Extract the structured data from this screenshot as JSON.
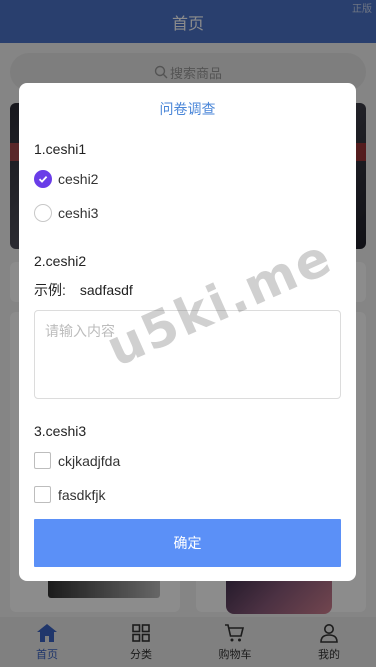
{
  "header": {
    "title": "首页",
    "corner_text": "正版"
  },
  "search": {
    "placeholder": "搜索商品"
  },
  "modal": {
    "title": "问卷调查",
    "questions": [
      {
        "title": "1.ceshi1",
        "options": [
          {
            "label": "ceshi2",
            "checked": true
          },
          {
            "label": "ceshi3",
            "checked": false
          }
        ]
      },
      {
        "title": "2.ceshi2",
        "example_label": "示例:",
        "example_value": "sadfasdf",
        "placeholder": "请输入内容"
      },
      {
        "title": "3.ceshi3",
        "options": [
          {
            "label": "ckjkadjfda",
            "checked": false
          },
          {
            "label": "fasdkfjk",
            "checked": false
          }
        ]
      }
    ],
    "confirm_label": "确定"
  },
  "watermark": "u5ki.me",
  "tabbar": [
    {
      "label": "首页",
      "icon": "home-icon",
      "active": true
    },
    {
      "label": "分类",
      "icon": "grid-icon",
      "active": false
    },
    {
      "label": "购物车",
      "icon": "cart-icon",
      "active": false
    },
    {
      "label": "我的",
      "icon": "user-icon",
      "active": false
    }
  ],
  "colors": {
    "header": "#4b74c9",
    "accent": "#5b90f7",
    "radio_checked": "#6a3de8",
    "modal_title": "#4a86d8",
    "tab_active": "#3b63c4"
  }
}
